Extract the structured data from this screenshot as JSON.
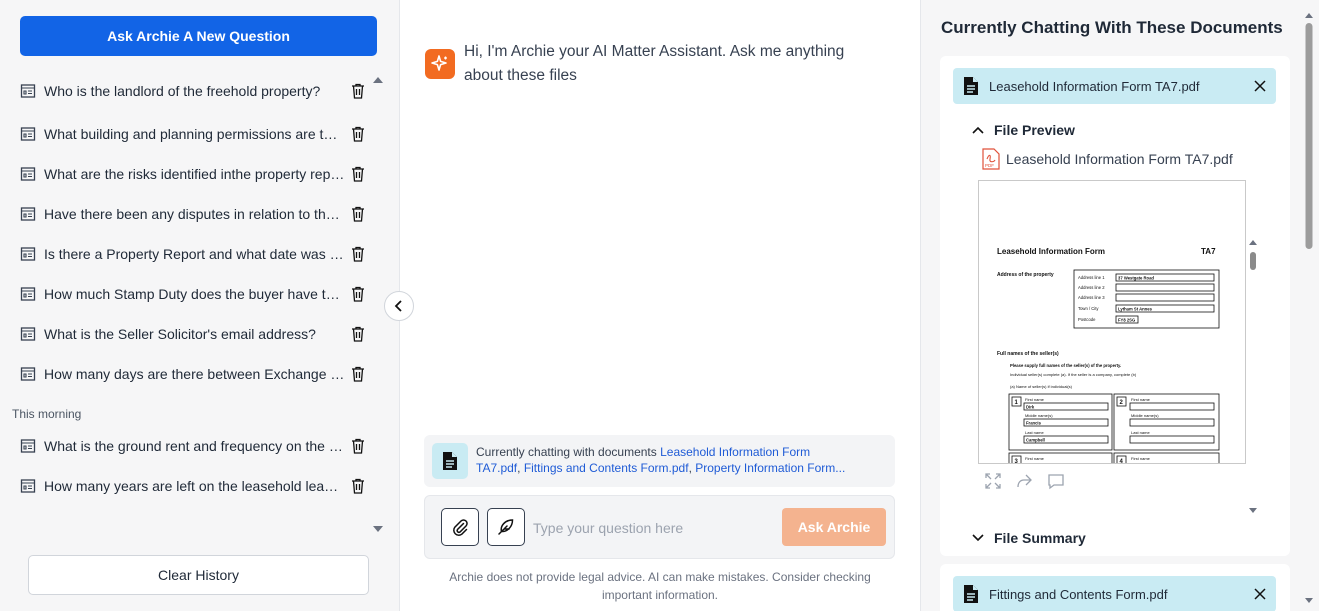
{
  "left": {
    "new_question_label": "Ask Archie A New Question",
    "history": [
      "Who is the landlord of the freehold property?",
      "What building and planning permissions are there?",
      "What are the risks identified inthe property report?",
      "Have there been any disputes in relation to the property?",
      "Is there a Property Report and what date was it issued?",
      "How much Stamp Duty does the buyer have to pay?",
      "What is the Seller Solicitor's email address?",
      "How many days are there between Exchange and Completion?"
    ],
    "section_label": "This morning",
    "history_morning": [
      "What is the ground rent and frequency on the lease?",
      "How many years are left on the leasehold lease?"
    ],
    "clear_label": "Clear History"
  },
  "chat": {
    "greeting": "Hi, I'm Archie your AI Matter Assistant. Ask me anything about these files",
    "context_prefix": "Currently chatting with documents ",
    "context_doc1_a": "Leasehold Information Form",
    "context_doc1_b": "TA7.pdf",
    "context_sep": ", ",
    "context_doc2": "Fittings and Contents Form.pdf",
    "context_doc3": "Property Information Form...",
    "input_placeholder": "Type your question here",
    "ask_label": "Ask Archie",
    "disclaimer": "Archie does not provide legal advice. AI can make mistakes. Consider checking important information."
  },
  "right": {
    "title": "Currently Chatting With These Documents",
    "doc1": {
      "name": "Leasehold Information Form TA7.pdf",
      "preview_label": "File Preview",
      "pdf_name": "Leasehold Information Form TA7.pdf",
      "summary_label": "File Summary"
    },
    "doc2": {
      "name": "Fittings and Contents Form.pdf"
    },
    "pdf_page": {
      "form_title": "Leasehold Information Form",
      "form_code": "TA7",
      "address_label": "Address of the property",
      "addr_fields": [
        "Address line 1",
        "Address line 2",
        "Address line 3",
        "Town / City",
        "Postcode"
      ],
      "addr_values": [
        "37 Westgate Road",
        "",
        "",
        "Lytham St Annes",
        "FY8 2SG"
      ],
      "sellers_label": "Full names of the seller(s)",
      "sellers_instr1": "Please supply full names of the seller(s) of the property.",
      "sellers_instr2": "Individual seller(s) complete (a). If the seller is a company, complete (b)",
      "sellers_instr3": "(a) Name of seller(s) if individual(s)",
      "box1_num": "1",
      "box2_num": "2",
      "box3_num": "3",
      "box4_num": "4",
      "first_name": "First name",
      "middle_names": "Middle name(s)",
      "last_name": "Last name",
      "box1_first": "Dirk",
      "box1_middle": "Francis",
      "box1_last": "Campbell"
    }
  },
  "colors": {
    "primary": "#1264e6",
    "accent_orange": "#f26b21",
    "ask_disabled": "#f4b38f",
    "doc_chip": "#c9ebf3",
    "link": "#1f5bd6"
  }
}
